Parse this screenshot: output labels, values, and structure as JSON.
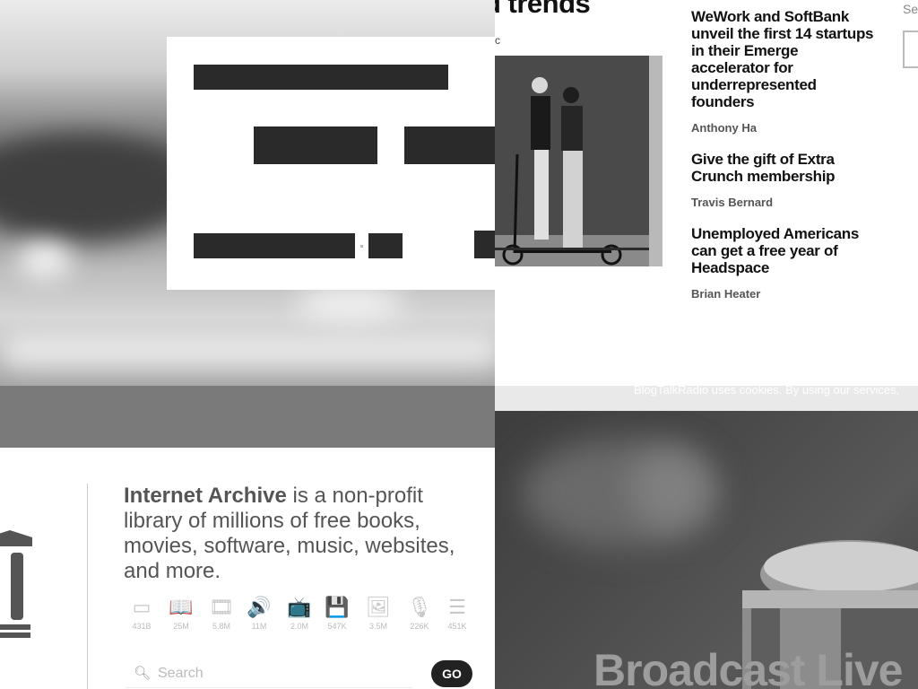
{
  "news": {
    "hero_title": "d trends",
    "hero_byline": "c",
    "articles": [
      {
        "title": "WeWork and SoftBank unveil the first 14 startups in their Emerge accelerator for underrepresented founders",
        "author": "Anthony Ha"
      },
      {
        "title": "Give the gift of Extra Crunch membership",
        "author": "Travis Bernard"
      },
      {
        "title": "Unemployed Americans can get a free year of Headspace",
        "author": "Brian Heater"
      }
    ],
    "search_label": "Se"
  },
  "archive": {
    "brand": "Internet Archive",
    "tagline": " is a non-profit library of millions of free books, movies, software, music, websites, and more.",
    "media": [
      {
        "icon": "web-icon",
        "glyph": "▭",
        "count": "431B"
      },
      {
        "icon": "book-icon",
        "glyph": "📖",
        "count": "25M"
      },
      {
        "icon": "film-icon",
        "glyph": "🎞",
        "count": "5.8M"
      },
      {
        "icon": "audio-icon",
        "glyph": "🔊",
        "count": "11M"
      },
      {
        "icon": "tv-icon",
        "glyph": "📺",
        "count": "2.0M"
      },
      {
        "icon": "software-icon",
        "glyph": "💾",
        "count": "547K"
      },
      {
        "icon": "image-icon",
        "glyph": "🖼",
        "count": "3.5M"
      },
      {
        "icon": "microphone-icon",
        "glyph": "🎙",
        "count": "226K"
      },
      {
        "icon": "list-icon",
        "glyph": "☰",
        "count": "451K"
      }
    ],
    "search_placeholder": "Search",
    "go_label": "GO"
  },
  "broadcast": {
    "cookie_text": "BlogTalkRadio uses cookies. By using our services,",
    "headline": "Broadcast Live"
  }
}
